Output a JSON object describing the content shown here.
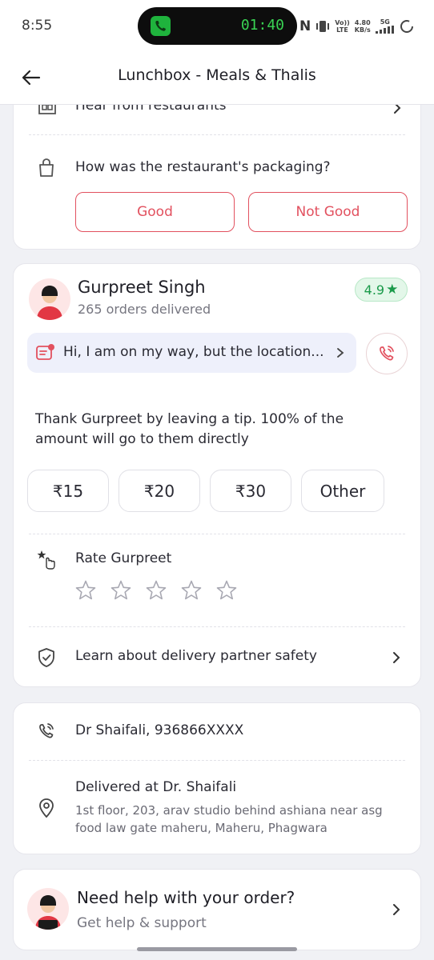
{
  "status_bar": {
    "time": "8:55",
    "call_timer": "01:40",
    "network_volte": [
      "Vo",
      ")",
      "LTE"
    ],
    "speed_value": "4.80",
    "speed_unit": "KB/s",
    "network_gen": "5G",
    "n_letter": "N"
  },
  "header": {
    "title": "Lunchbox - Meals & Thalis"
  },
  "packaging_card": {
    "partial_row_label": "Hear from restaurants",
    "question": "How was the restaurant's packaging?",
    "good_label": "Good",
    "not_good_label": "Not Good"
  },
  "rider_card": {
    "name": "Gurpreet Singh",
    "orders": "265 orders delivered",
    "rating": "4.9",
    "rating_star": "★",
    "message": "Hi, I am on my way, but the location...",
    "tip_text": "Thank Gurpreet by leaving a tip. 100% of the amount will go to them directly",
    "tips": [
      "₹15",
      "₹20",
      "₹30",
      "Other"
    ],
    "rate_label": "Rate Gurpreet",
    "stars_filled": 0,
    "stars_total": 5,
    "safety_label": "Learn about delivery partner safety"
  },
  "address_card": {
    "contact": "Dr Shaifali, 936866XXXX",
    "delivered_title": "Delivered at Dr. Shaifali",
    "address": "1st floor, 203, arav studio behind ashiana near asg food law gate maheru, Maheru, Phagwara"
  },
  "help_card": {
    "title": "Need help with your order?",
    "subtitle": "Get help & support"
  },
  "colors": {
    "accent_red": "#e2515f",
    "rating_green": "#1a9a4a",
    "call_green": "#39d353"
  }
}
